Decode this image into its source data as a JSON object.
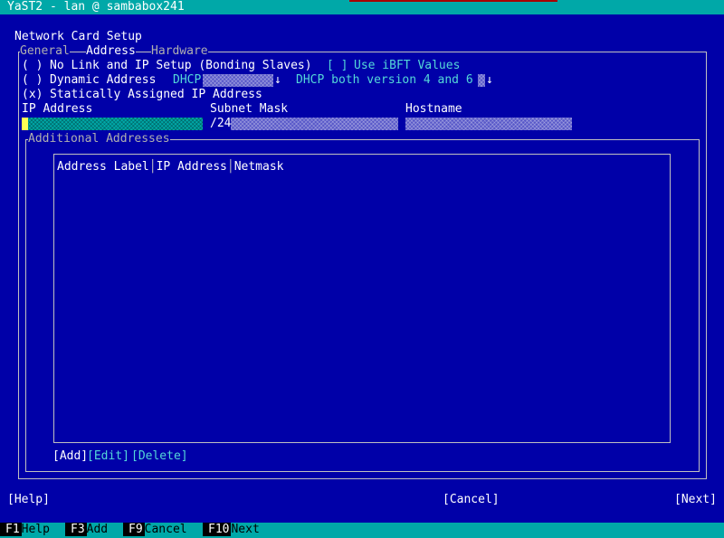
{
  "window": {
    "title": "YaST2 - lan @ sambabox241"
  },
  "dialog": {
    "title": "Network Card Setup"
  },
  "tabs": [
    {
      "label": "General"
    },
    {
      "label": "Address"
    },
    {
      "label": "Hardware"
    }
  ],
  "options": {
    "no_link": {
      "mark": "( )",
      "label": "No Link and IP Setup (Bonding Slaves)"
    },
    "ibft": {
      "mark": "[ ]",
      "label": "Use iBFT Values"
    },
    "dynamic": {
      "mark": "( )",
      "label": "Dynamic Address",
      "select_value": "DHCP",
      "version_value": "DHCP both version 4 and 6",
      "arrow": "↓"
    },
    "static": {
      "mark": "(x)",
      "label": "Statically Assigned IP Address"
    }
  },
  "fields": {
    "ip_label": "IP Address",
    "ip_value": "",
    "mask_label": "Subnet Mask",
    "mask_value": "/24",
    "host_label": "Hostname",
    "host_value": ""
  },
  "additional": {
    "title": "Additional Addresses",
    "columns": [
      "Address Label",
      "IP Address",
      "Netmask"
    ],
    "buttons": {
      "add": "[Add]",
      "edit": "[Edit]",
      "delete": "[Delete]"
    }
  },
  "footer": {
    "help": "[Help]",
    "cancel": "[Cancel]",
    "next": "[Next]"
  },
  "fkeys": [
    {
      "key": "F1",
      "label": "Help"
    },
    {
      "key": "F3",
      "label": "Add"
    },
    {
      "key": "F9",
      "label": "Cancel"
    },
    {
      "key": "F10",
      "label": "Next"
    }
  ]
}
